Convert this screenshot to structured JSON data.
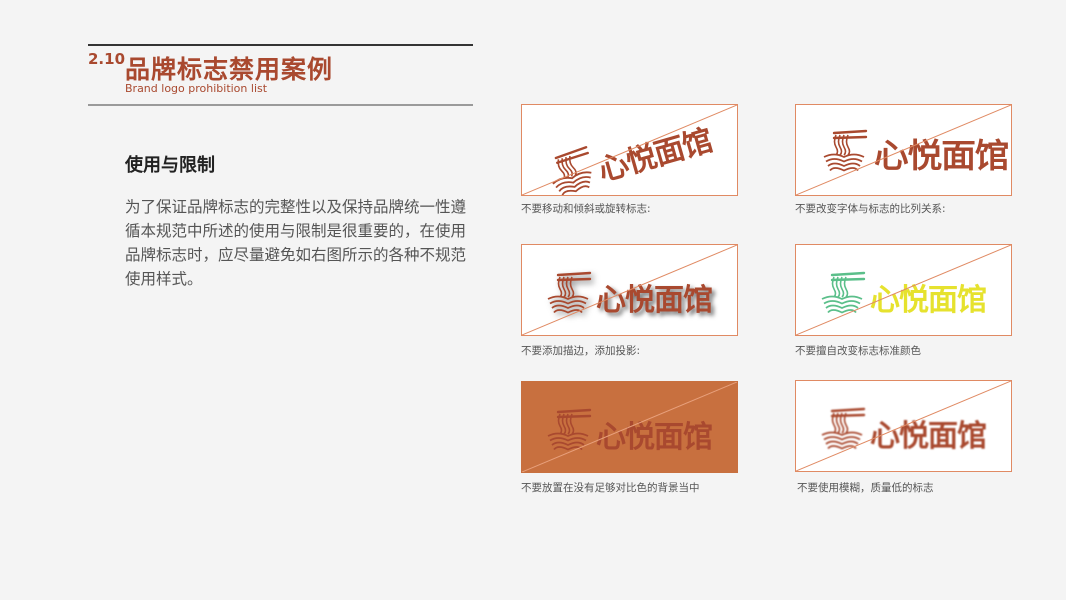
{
  "header": {
    "section_number": "2.10",
    "title": "品牌标志禁用案例",
    "subtitle": "Brand logo prohibition list"
  },
  "section": {
    "heading": "使用与限制",
    "body": "为了保证品牌标志的完整性以及保持品牌统一性遵循本规范中所述的使用与限制是很重要的，在使用品牌标志时，应尽量避免如右图所示的各种不规范使用样式。"
  },
  "logo": {
    "wordmark": "心悦面馆"
  },
  "examples": [
    {
      "caption": "不要移动和倾斜或旋转标志:",
      "logo_color": "#a9492f",
      "background": "#ffffff"
    },
    {
      "caption": "不要改变字体与标志的比列关系:",
      "logo_color": "#a9492f",
      "background": "#ffffff"
    },
    {
      "caption": "不要添加描边，添加投影:",
      "logo_color": "#a9492f",
      "background": "#ffffff"
    },
    {
      "caption": "不要擅自改变标志标准颜色",
      "logo_color": "#e6e22e",
      "icon_color": "#5bbf8a",
      "background": "#ffffff"
    },
    {
      "caption": "不要放置在没有足够对比色的背景当中",
      "logo_color": "#a9492f",
      "background": "#c8703f"
    },
    {
      "caption": "不要使用模糊，质量低的标志",
      "logo_color": "#a9492f",
      "background": "#ffffff"
    }
  ],
  "colors": {
    "brand": "#a9492f",
    "border": "#e08a63",
    "text": "#555555"
  }
}
